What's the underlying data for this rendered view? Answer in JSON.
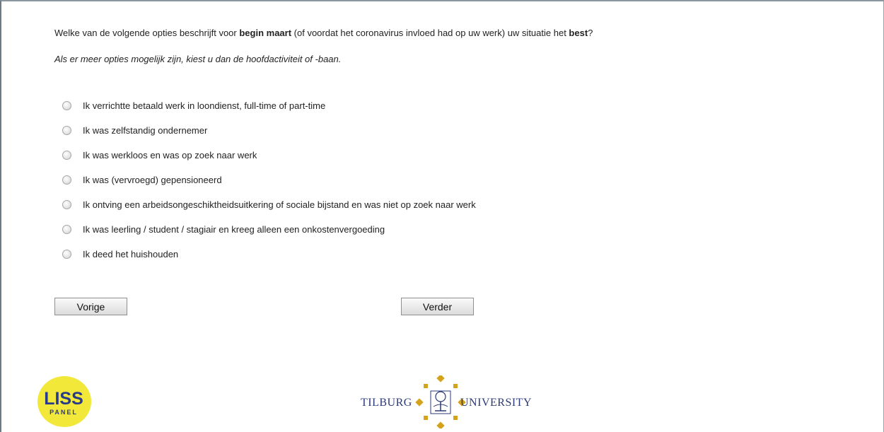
{
  "question": {
    "part1": "Welke van de volgende opties beschrijft voor ",
    "bold1": "begin maart",
    "part2": " (of voordat het coronavirus invloed had op uw werk) uw situatie het ",
    "bold2": "best",
    "part3": "?"
  },
  "instruction": "Als er meer opties mogelijk zijn, kiest u dan de hoofdactiviteit of -baan.",
  "options": [
    {
      "label": "Ik verrichtte betaald werk in loondienst, full-time of part-time"
    },
    {
      "label": "Ik was zelfstandig ondernemer"
    },
    {
      "label": "Ik was werkloos en was op zoek naar werk"
    },
    {
      "label": "Ik was (vervroegd) gepensioneerd"
    },
    {
      "label": "Ik ontving een arbeidsongeschiktheidsuitkering of sociale bijstand en was niet op zoek naar werk"
    },
    {
      "label": "Ik was leerling / student / stagiair en kreeg alleen een onkostenvergoeding"
    },
    {
      "label": "Ik deed het huishouden"
    }
  ],
  "buttons": {
    "previous_label": "Vorige",
    "next_label": "Verder"
  },
  "logos": {
    "liss_text": "LISS",
    "liss_subtext": "PANEL",
    "tilburg_left": "Tilburg",
    "tilburg_right": "University"
  },
  "colors": {
    "liss_yellow": "#f2e83a",
    "liss_blue": "#283a8a",
    "tilburg_gold": "#d4a21b",
    "tilburg_blue": "#2c3a78"
  }
}
